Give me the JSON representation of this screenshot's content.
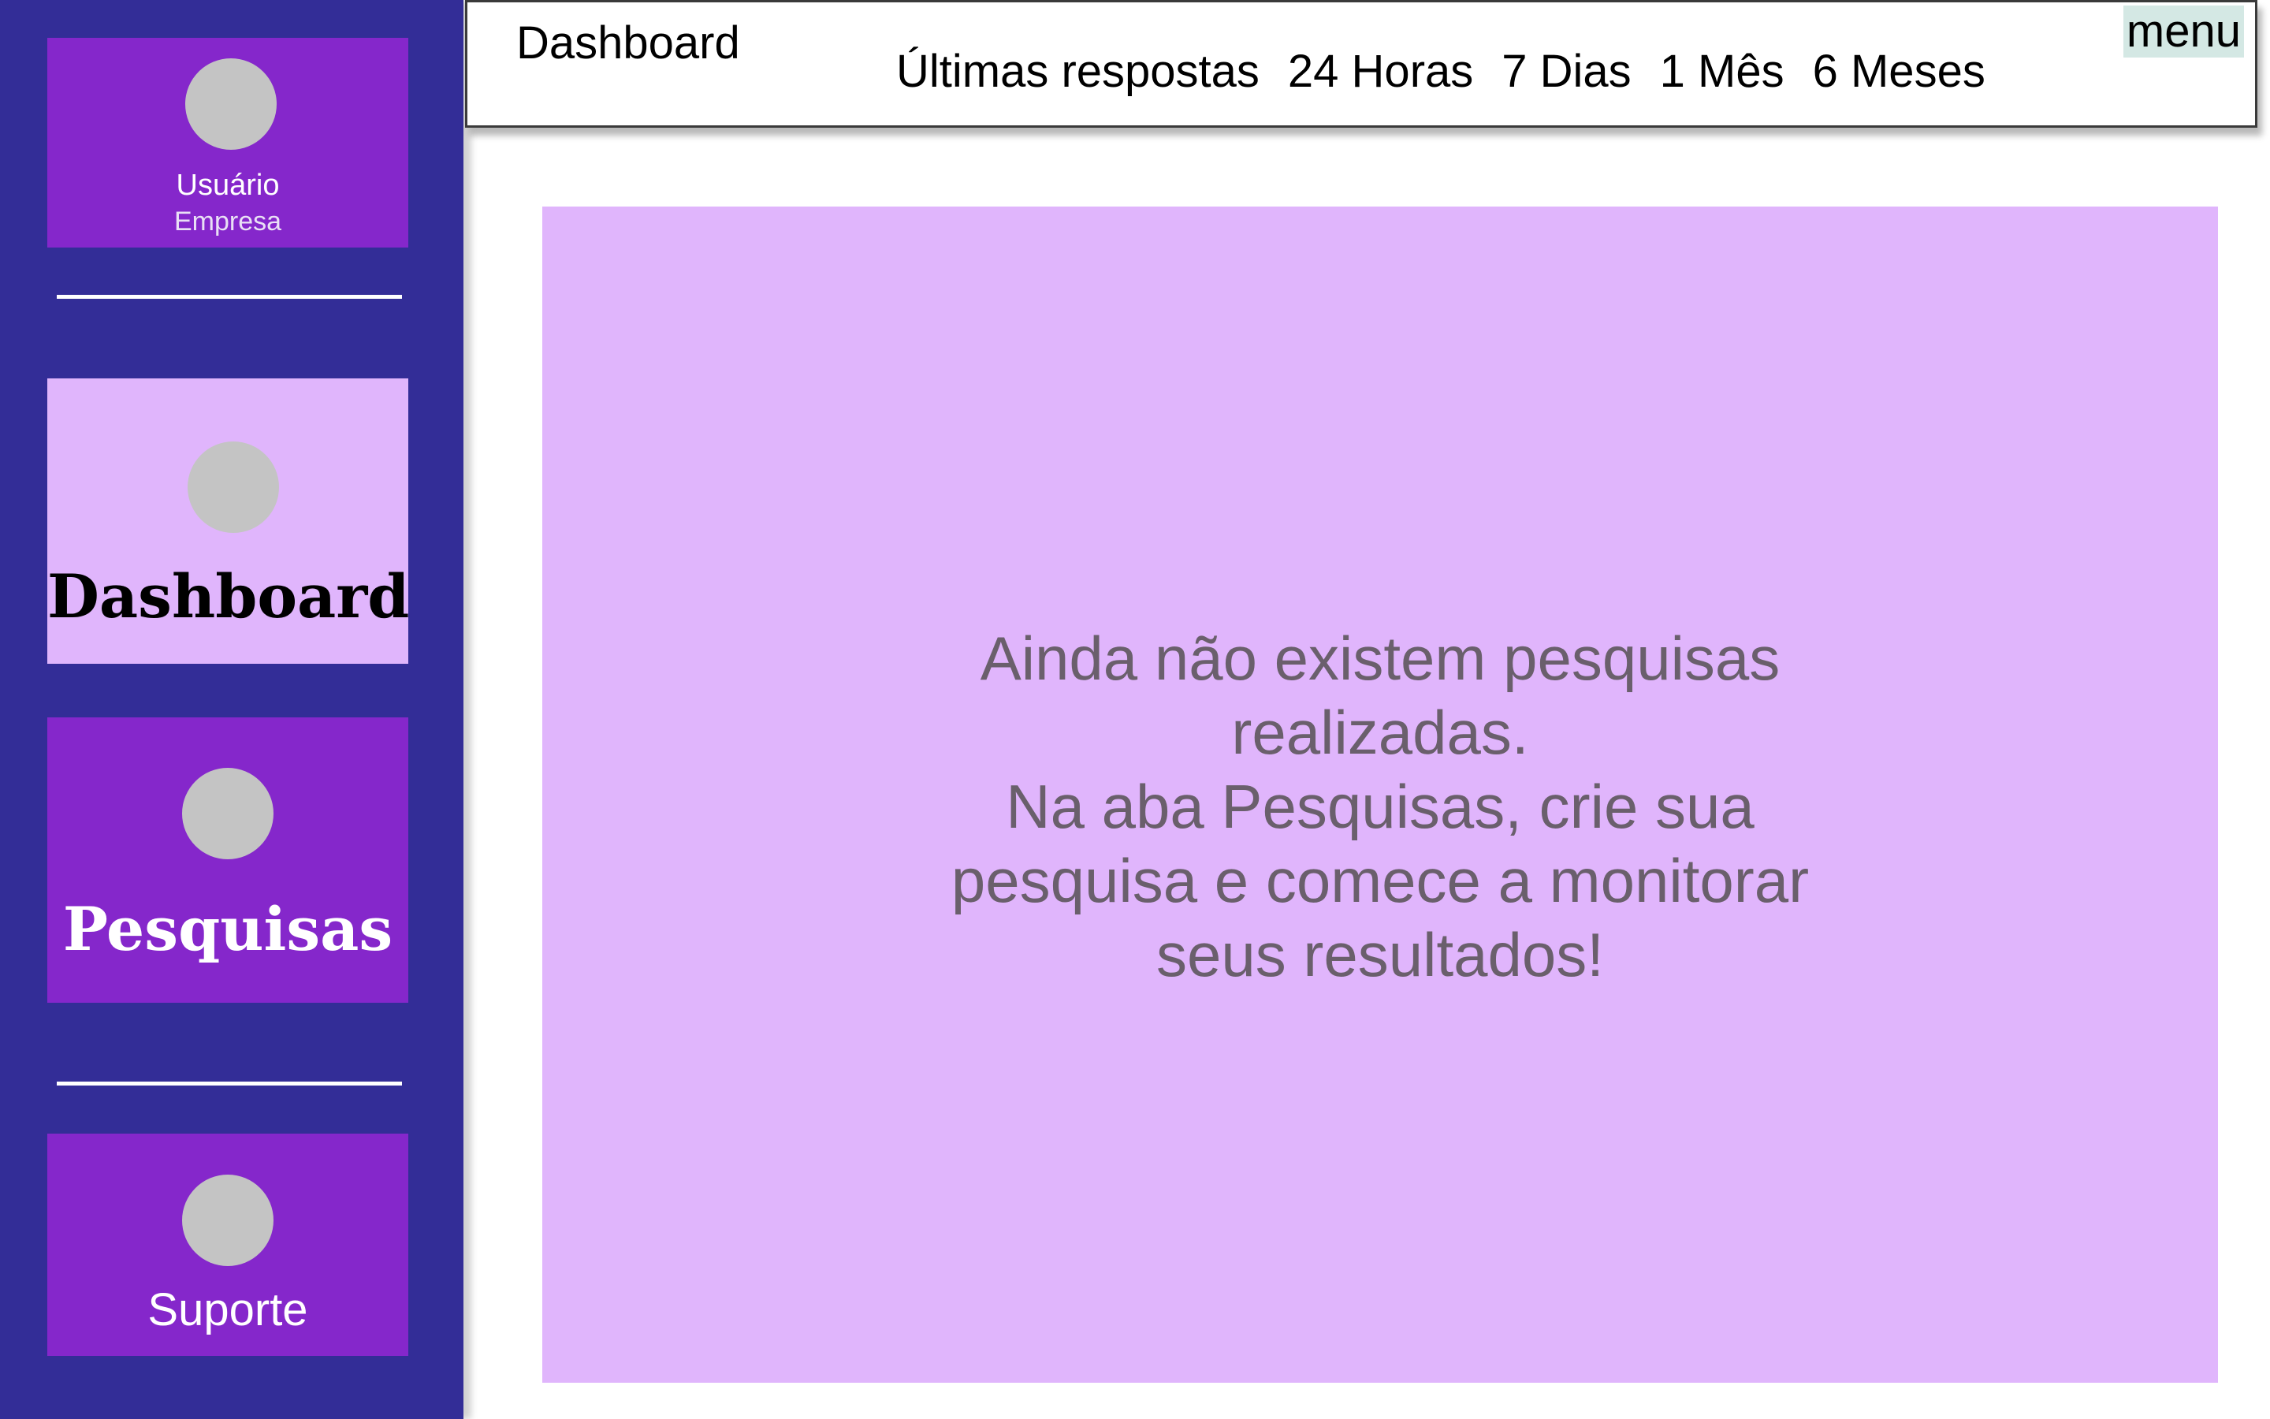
{
  "sidebar": {
    "user": {
      "name": "Usuário",
      "company": "Empresa"
    },
    "items": [
      {
        "label": "Dashboard",
        "active": true
      },
      {
        "label": "Pesquisas",
        "active": false
      },
      {
        "label": "Suporte",
        "active": false
      }
    ]
  },
  "header": {
    "title": "Dashboard",
    "filters": [
      "Últimas respostas",
      "24 Horas",
      "7 Dias",
      "1 Mês",
      "6 Meses"
    ],
    "menu_label": "menu"
  },
  "main": {
    "empty_message": [
      "Ainda não existem pesquisas",
      "realizadas.",
      "Na aba Pesquisas, crie sua",
      "pesquisa e comece a monitorar",
      "seus resultados!"
    ]
  },
  "colors": {
    "sidebar_bg": "#332d97",
    "card_purple": "#8527cb",
    "card_active": "#e0b5fc",
    "panel_bg": "#e0b5fc",
    "avatar_placeholder": "#c4c4c4",
    "menu_bg": "#d4e8e4"
  },
  "icons": {
    "user": "avatar-placeholder-icon",
    "dashboard": "dashboard-icon",
    "pesquisas": "pesquisas-icon",
    "suporte": "suporte-icon"
  }
}
